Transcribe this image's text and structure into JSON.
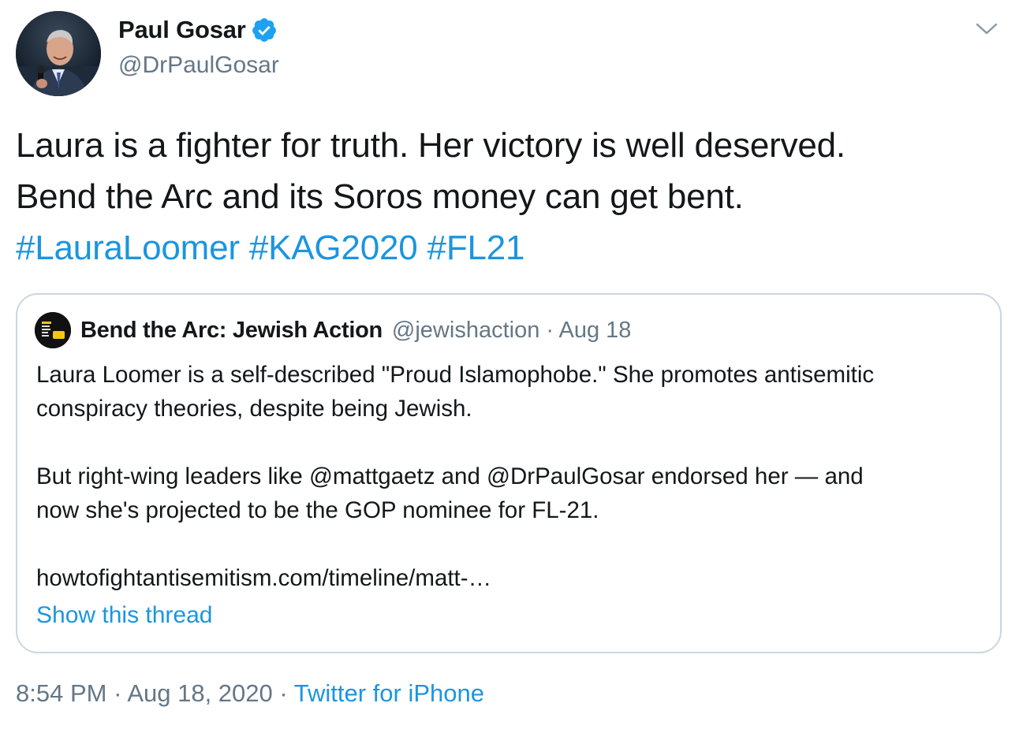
{
  "author": {
    "display_name": "Paul Gosar",
    "handle": "@DrPaulGosar",
    "verified": true
  },
  "tweet": {
    "line1": "Laura is a fighter for truth.  Her victory is well deserved.",
    "line2": "Bend the Arc and its Soros money can get bent.",
    "hashtags": [
      "#LauraLoomer",
      "#KAG2020",
      "#FL21"
    ]
  },
  "quoted": {
    "display_name": "Bend the Arc: Jewish Action",
    "meta": "@jewishaction · Aug 18",
    "lines": [
      "Laura Loomer is a self-described \"Proud Islamophobe.\" She promotes antisemitic",
      "conspiracy theories, despite being Jewish.",
      "But right-wing leaders like @mattgaetz and @DrPaulGosar endorsed her — and",
      "now she's projected to be the GOP nominee for FL-21.",
      "howtofightantisemitism.com/timeline/matt-…"
    ],
    "show_thread": "Show this thread"
  },
  "footer": {
    "time": "8:54 PM",
    "date": "Aug 18, 2020",
    "source": "Twitter for iPhone",
    "separator": "·"
  },
  "colors": {
    "link": "#1b95e0",
    "muted": "#657786",
    "border": "#ccd6dd",
    "verified": "#1da1f2"
  },
  "icons": {
    "verified": "verified-badge-icon",
    "menu": "chevron-down-icon"
  }
}
